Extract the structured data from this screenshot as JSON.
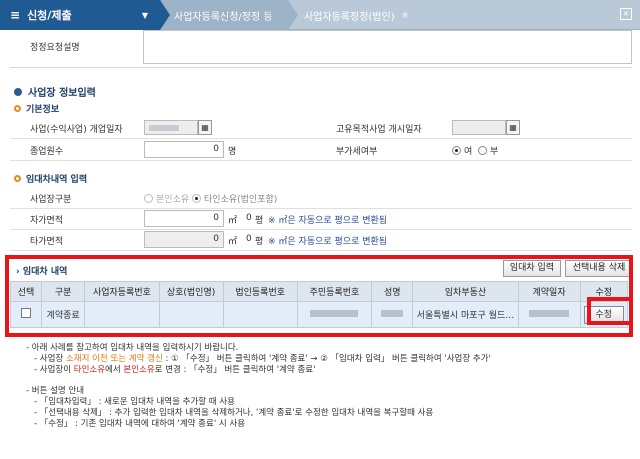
{
  "nav": {
    "main_label": "신청/제출",
    "crumb1": "사업자등록신청/정정 등",
    "crumb2": "사업자등록정정(법인)"
  },
  "memo": {
    "label": "정정요청설명"
  },
  "section_business": {
    "title": "사업장 정보입력",
    "basic_title": "기본정보",
    "start_date_label": "사업(수익사업) 개업일자",
    "unique_start_label": "고유목적사업 개시일자",
    "employees_label": "종업원수",
    "employees_value": "0",
    "employees_unit": "명",
    "vat_label": "부가세여부",
    "vat_yes": "여",
    "vat_no": "부",
    "vat_selected": "여"
  },
  "section_lease": {
    "title": "임대차내역 입력",
    "place_type_label": "사업장구분",
    "own_label": "본인소유",
    "other_label": "타인소유(법인포함)",
    "own_area_label": "자가면적",
    "other_area_label": "타가면적",
    "area_value": "0",
    "area_unit": "㎡",
    "pyeong_value": "0",
    "pyeong_unit": "평",
    "area_hint": "※ ㎡은 자동으로 평으로 변환됨"
  },
  "lease_table": {
    "title": "임대차 내역",
    "add_button": "임대차 입력",
    "delete_button": "선택내용 삭제",
    "columns": [
      "선택",
      "구분",
      "사업자등록번호",
      "상호(법인명)",
      "법인등록번호",
      "주민등록번호",
      "성명",
      "임차부동산",
      "계약일자",
      "수정"
    ],
    "rows": [
      {
        "type": "계약종료",
        "address": "서울특별시 마포구 월드…",
        "edit_label": "수정"
      }
    ]
  },
  "notes": {
    "line1": "- 아래 사례를 참고하여 임대차 내역을 입력하시기 바랍니다.",
    "line2_a": "- 사업장 ",
    "line2_b": "소재지 이전 또는 계약 갱신",
    "line2_c": " : ① 「수정」 버튼 클릭하여 '계약 종료' → ② 「임대차 입력」 버튼 클릭하여 '사업장 추가'",
    "line3_a": "- 사업장이 ",
    "line3_b": "타인소유",
    "line3_c": "에서 ",
    "line3_d": "본인소유",
    "line3_e": "로 변경 : 「수정」 버튼 클릭하여 '계약 종료'",
    "line4": "- 버튼 설명 안내",
    "line5": "- 「임대차입력」 : 새로운 임대차 내역을 추가할 때 사용",
    "line6": "- 「선택내용 삭제」 : 추가 입력한 임대차 내역을 삭제하거나, '계약 종료'로 수정한 임대차 내역을 복구할때 사용",
    "line7": "- 「수정」 : 기존 임대차 내역에 대하여 '계약 종료' 시 사용"
  }
}
